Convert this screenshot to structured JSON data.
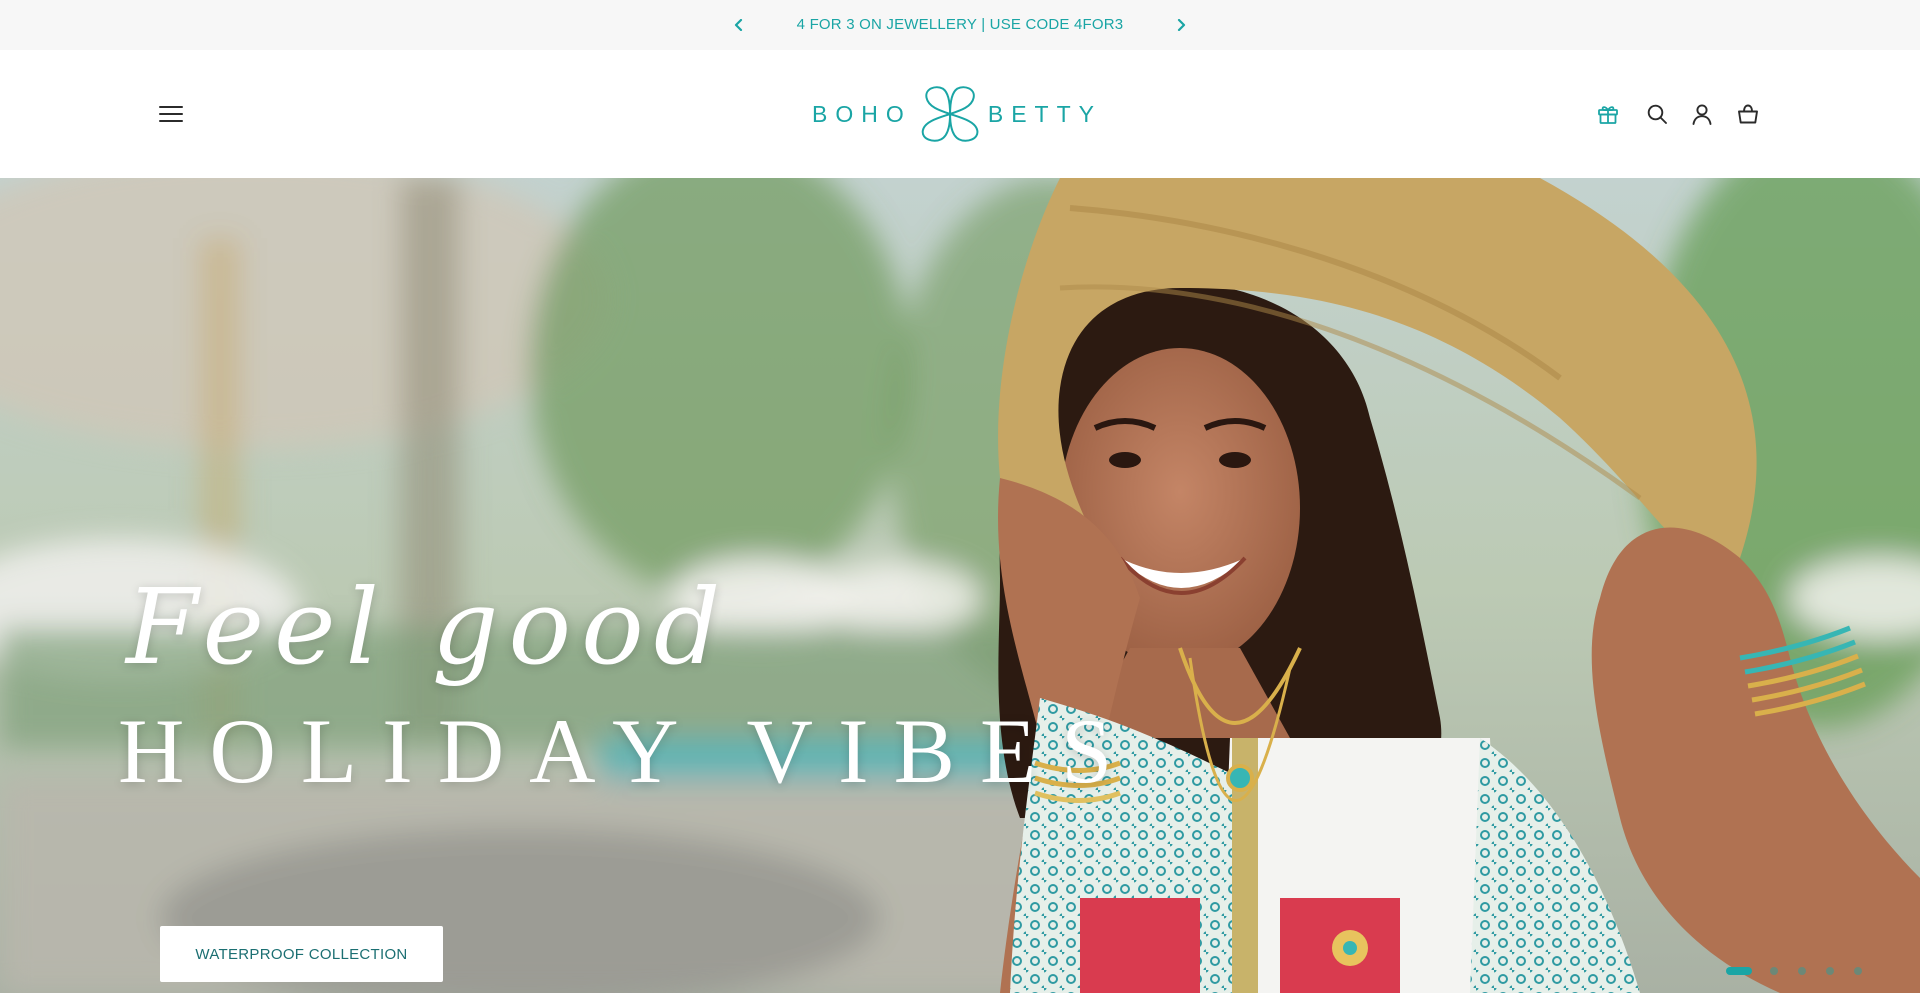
{
  "announcement": {
    "text": "4 FOR 3 ON JEWELLERY | USE CODE 4FOR3",
    "prev_icon": "chevron-left-icon",
    "next_icon": "chevron-right-icon"
  },
  "header": {
    "logo_left": "BOHO",
    "logo_right": "BETTY",
    "menu_icon": "hamburger-menu-icon",
    "icons": [
      "gift-icon",
      "search-icon",
      "account-icon",
      "cart-icon"
    ]
  },
  "hero": {
    "tagline": "Feel good",
    "headline": "HOLIDAY VIBES",
    "cta_label": "WATERPROOF COLLECTION",
    "slide_count": 5,
    "active_slide": 1
  },
  "colors": {
    "brand_teal": "#1aa5a5",
    "announcement_bg": "#f7f7f7",
    "cta_text": "#1b6f72",
    "icon_dark": "#2b2b2b"
  }
}
